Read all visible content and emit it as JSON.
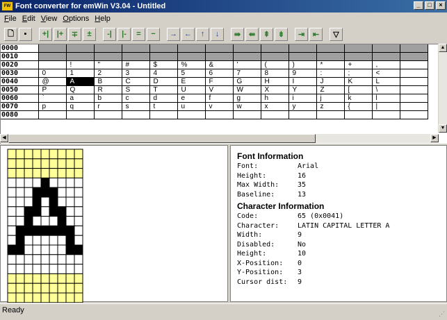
{
  "window": {
    "title": "Font converter for emWin V3.04 - Untitled",
    "app_icon": "FW"
  },
  "menu": [
    "File",
    "Edit",
    "View",
    "Options",
    "Help"
  ],
  "toolbar": {
    "buttons": [
      {
        "name": "new-file",
        "glyph": "🗋"
      },
      {
        "name": "save-file",
        "glyph": "▪"
      },
      {
        "name": "enable-char",
        "glyph": "+|"
      },
      {
        "name": "enable-range",
        "glyph": "|+"
      },
      {
        "name": "enable-row",
        "glyph": "∓"
      },
      {
        "name": "enable-all",
        "glyph": "±"
      },
      {
        "name": "disable-char",
        "glyph": "-|"
      },
      {
        "name": "disable-range",
        "glyph": "|-"
      },
      {
        "name": "disable-row",
        "glyph": "="
      },
      {
        "name": "disable-all",
        "glyph": "−"
      },
      {
        "name": "move-right",
        "glyph": "→"
      },
      {
        "name": "move-left",
        "glyph": "←"
      },
      {
        "name": "move-up",
        "glyph": "↑"
      },
      {
        "name": "move-down",
        "glyph": "↓"
      },
      {
        "name": "widen-right",
        "glyph": "⇛"
      },
      {
        "name": "widen-left",
        "glyph": "⇚"
      },
      {
        "name": "raise",
        "glyph": "⇞"
      },
      {
        "name": "lower",
        "glyph": "⇟"
      },
      {
        "name": "cursor-right",
        "glyph": "⇥"
      },
      {
        "name": "cursor-left",
        "glyph": "⇤"
      },
      {
        "name": "filter",
        "glyph": "▽"
      }
    ]
  },
  "charmap": {
    "rows": [
      {
        "code": "0000",
        "cells": [
          "",
          "",
          "",
          "",
          "",
          "",
          "",
          "",
          "",
          "",
          "",
          "",
          "",
          ""
        ],
        "disabled": true
      },
      {
        "code": "0010",
        "cells": [
          "",
          "",
          "",
          "",
          "",
          "",
          "",
          "",
          "",
          "",
          "",
          "",
          "",
          ""
        ],
        "disabled": true
      },
      {
        "code": "0020",
        "cells": [
          "",
          "!",
          "\"",
          "#",
          "$",
          "%",
          "&",
          "'",
          "(",
          ")",
          "*",
          "+",
          ",",
          ""
        ]
      },
      {
        "code": "0030",
        "cells": [
          "0",
          "1",
          "2",
          "3",
          "4",
          "5",
          "6",
          "7",
          "8",
          "9",
          ":",
          ";",
          "<",
          ""
        ]
      },
      {
        "code": "0040",
        "cells": [
          "@",
          "A",
          "B",
          "C",
          "D",
          "E",
          "F",
          "G",
          "H",
          "I",
          "J",
          "K",
          "L",
          ""
        ]
      },
      {
        "code": "0050",
        "cells": [
          "P",
          "Q",
          "R",
          "S",
          "T",
          "U",
          "V",
          "W",
          "X",
          "Y",
          "Z",
          "[",
          "\\",
          ""
        ]
      },
      {
        "code": "0060",
        "cells": [
          "`",
          "a",
          "b",
          "c",
          "d",
          "e",
          "f",
          "g",
          "h",
          "i",
          "j",
          "k",
          "l",
          ""
        ]
      },
      {
        "code": "0070",
        "cells": [
          "p",
          "q",
          "r",
          "s",
          "t",
          "u",
          "v",
          "w",
          "x",
          "y",
          "z",
          "{",
          "|",
          ""
        ]
      },
      {
        "code": "0080",
        "cells": [
          "",
          "",
          "",
          "",
          "",
          "",
          "",
          "",
          "",
          "",
          "",
          "",
          "",
          ""
        ]
      }
    ],
    "selected": {
      "row": 4,
      "col": 1
    }
  },
  "glyph": {
    "cols": 9,
    "rows": 16,
    "bitmap": [
      "000000000",
      "000000000",
      "000000000",
      "000010000",
      "000111000",
      "000101000",
      "001101100",
      "001000100",
      "011111110",
      "010000010",
      "110000011",
      "000000000",
      "000000000",
      "000000000",
      "000000000",
      "000000000"
    ],
    "active_rows": [
      3,
      12
    ],
    "colors": {
      "on": "#000000",
      "off": "#ffffff",
      "inactive": "#ffff99",
      "line": "#000000"
    }
  },
  "font_info": {
    "heading": "Font Information",
    "rows": [
      {
        "k": "Font:",
        "v": "Arial"
      },
      {
        "k": "Height:",
        "v": "16"
      },
      {
        "k": "Max Width:",
        "v": "35"
      },
      {
        "k": "Baseline:",
        "v": "13"
      }
    ]
  },
  "char_info": {
    "heading": "Character Information",
    "rows": [
      {
        "k": "Code:",
        "v": "65 (0x0041)"
      },
      {
        "k": "Character:",
        "v": "LATIN CAPITAL LETTER A"
      },
      {
        "k": "Width:",
        "v": "9"
      },
      {
        "k": "Disabled:",
        "v": "No"
      },
      {
        "k": "Height:",
        "v": "10"
      },
      {
        "k": "X-Position:",
        "v": "0"
      },
      {
        "k": "Y-Position:",
        "v": "3"
      },
      {
        "k": "Cursor dist:",
        "v": "9"
      }
    ]
  },
  "status": {
    "text": "Ready"
  }
}
